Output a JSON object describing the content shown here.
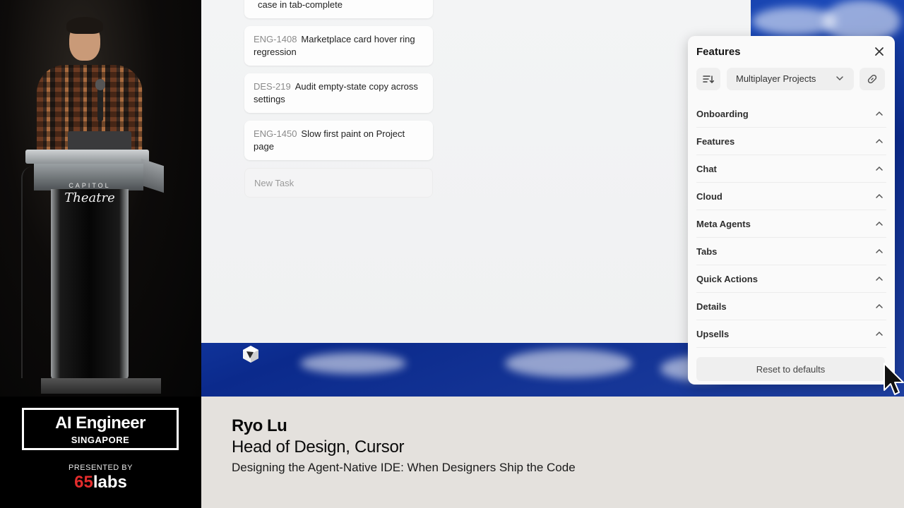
{
  "event": {
    "title": "AI Engineer",
    "subtitle": "SINGAPORE",
    "presented_by": "PRESENTED BY",
    "sponsor_number": "65",
    "sponsor_word": "labs",
    "venue_brand_top": "CAPITOL",
    "venue_brand_bottom": "Theatre"
  },
  "speaker": {
    "name": "Ryo Lu",
    "role": "Head of Design, Cursor",
    "talk": "Designing the Agent-Native IDE: When Designers Ship the Code"
  },
  "tasks": [
    {
      "id": "",
      "title": "case in tab-complete"
    },
    {
      "id": "ENG-1408",
      "title": "Marketplace card hover ring regression"
    },
    {
      "id": "DES-219",
      "title": "Audit empty-state copy across settings"
    },
    {
      "id": "ENG-1450",
      "title": "Slow first paint on Project page"
    }
  ],
  "new_task_placeholder": "New Task",
  "features_panel": {
    "title": "Features",
    "project_select": "Multiplayer Projects",
    "sections": [
      "Onboarding",
      "Features",
      "Chat",
      "Cloud",
      "Meta Agents",
      "Tabs",
      "Quick Actions",
      "Details",
      "Upsells"
    ],
    "reset_label": "Reset to defaults"
  },
  "icons": {
    "close": "close-icon",
    "sort": "sort-icon",
    "chevron": "chevron-down-icon",
    "link": "link-icon",
    "caret": "chevron-up-icon",
    "app_logo": "cursor-logo-icon",
    "pointer": "mouse-pointer-icon"
  },
  "colors": {
    "lower_third_bg": "#e4e1dd",
    "sponsor_accent": "#e32c2c",
    "desktop_blue": "#1a48b8"
  }
}
